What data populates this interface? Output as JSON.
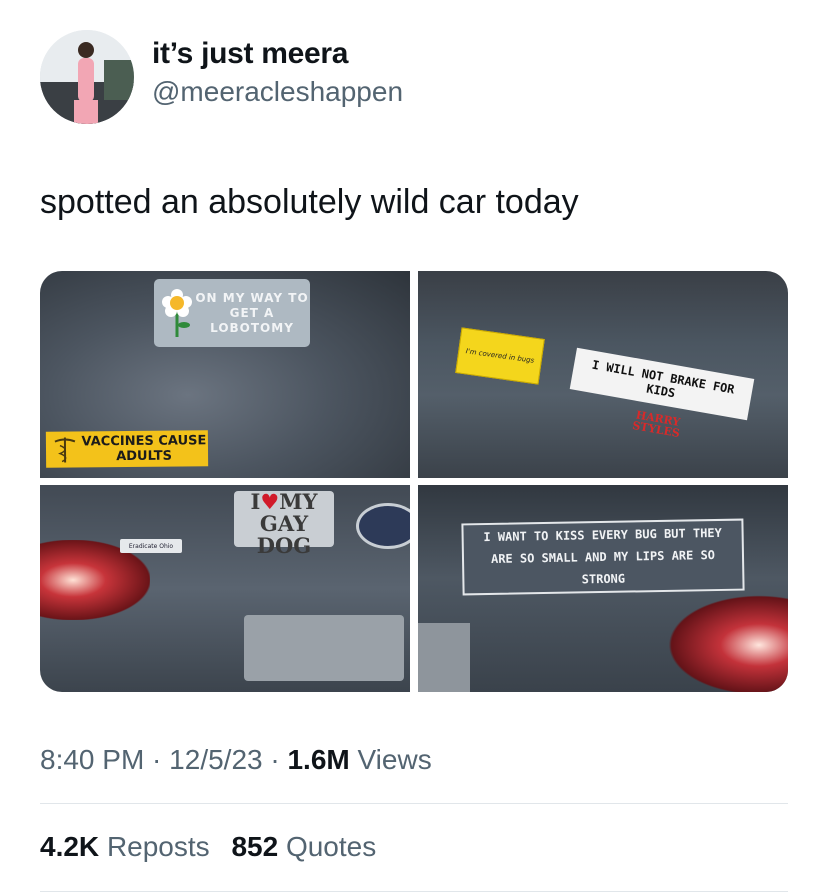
{
  "author": {
    "display_name": "it’s just meera",
    "handle": "@meeracleshappen"
  },
  "tweet": {
    "text": "spotted an absolutely wild car today"
  },
  "media": {
    "stickers": {
      "lobotomy": "ON MY WAY TO GET A LOBOTOMY",
      "vaccines": "VACCINES CAUSE ADULTS",
      "bugs": "I'm covered in bugs",
      "brake": "I WILL NOT BRAKE FOR KIDS",
      "harry": "HARRY STYLES",
      "ilove_i": "I",
      "ilove_heart": "♥",
      "ilove_rest": "MY GAY DOG",
      "eradicate": "Eradicate Ohio",
      "kiss": "I WANT TO KISS EVERY BUG BUT THEY ARE SO SMALL AND MY LIPS ARE SO STRONG"
    }
  },
  "meta": {
    "time": "8:40 PM",
    "sep1": " · ",
    "date": "12/5/23",
    "sep2": " · ",
    "views_count": "1.6M",
    "views_label": "Views"
  },
  "stats": {
    "reposts_count": "4.2K",
    "reposts_label": "Reposts",
    "quotes_count": "852",
    "quotes_label": "Quotes"
  }
}
